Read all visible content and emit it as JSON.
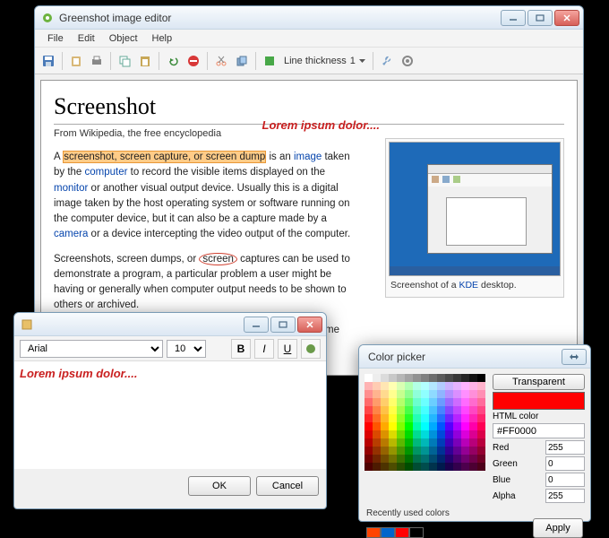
{
  "main": {
    "title": "Greenshot image editor",
    "menu": {
      "file": "File",
      "edit": "Edit",
      "object": "Object",
      "help": "Help"
    },
    "toolbar": {
      "thickness_label": "Line thickness",
      "thickness_value": "1"
    },
    "doc": {
      "heading": "Screenshot",
      "subtitle": "From Wikipedia, the free encyclopedia",
      "note": "Lorem ipsum dolor....",
      "p1_a": "A ",
      "p1_hl": "screenshot, screen capture, or screen dump",
      "p1_b": " is an ",
      "p1_link1": "image",
      "p1_c": " taken by the ",
      "p1_link2": "computer",
      "p1_d": " to record the visible items displayed on the ",
      "p1_link3": "monitor",
      "p1_e": " or another visual output device. Usually this is a digital image taken by the host operating system or software running on the computer device, but it can also be a capture made by a ",
      "p1_link4": "camera",
      "p1_f": " or a device intercepting the video output of the computer.",
      "p2_a": "Screenshots, screen dumps, or ",
      "p2_mark": "screen",
      "p2_b": " captures can be used to demonstrate a program, a particular problem a user might be having or generally when computer output needs to be shown to others or archived.",
      "p3": "All three terms are often used interchangeably; however, some people distinguish between them as follows:",
      "thumb_cap_a": "Screenshot of a ",
      "thumb_cap_link": "KDE",
      "thumb_cap_b": " desktop."
    }
  },
  "texted": {
    "font": "Arial",
    "size": "10",
    "content": "Lorem ipsum dolor....",
    "ok": "OK",
    "cancel": "Cancel"
  },
  "colpick": {
    "title": "Color picker",
    "transparent": "Transparent",
    "html_label": "HTML color",
    "html_value": "#FF0000",
    "red_label": "Red",
    "red_value": "255",
    "green_label": "Green",
    "green_value": "0",
    "blue_label": "Blue",
    "blue_value": "0",
    "alpha_label": "Alpha",
    "alpha_value": "255",
    "recent_label": "Recently used colors",
    "apply": "Apply",
    "swatch": "#FF0000",
    "recent": [
      "#ff4400",
      "#0066cc",
      "#ff0000",
      "#000000"
    ]
  }
}
